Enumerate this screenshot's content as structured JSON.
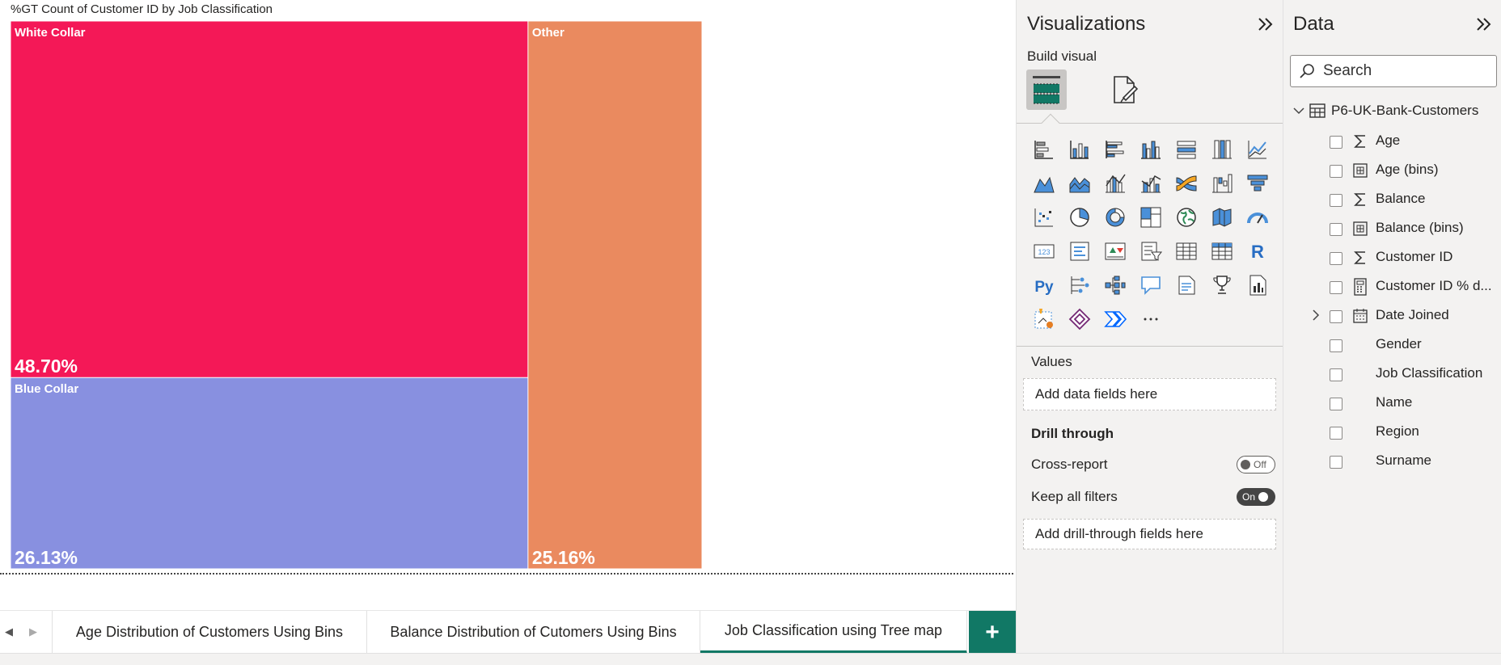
{
  "chart": {
    "title": "%GT Count of Customer ID by Job Classification"
  },
  "chart_data": {
    "type": "treemap",
    "title": "%GT Count of Customer ID by Job Classification",
    "items": [
      {
        "name": "White Collar",
        "value": 48.7,
        "label": "48.70%",
        "color": "#f41857"
      },
      {
        "name": "Blue Collar",
        "value": 26.13,
        "label": "26.13%",
        "color": "#8890e0"
      },
      {
        "name": "Other",
        "value": 25.16,
        "label": "25.16%",
        "color": "#ea8a5f"
      }
    ]
  },
  "tabs": {
    "nav_prev": "◀",
    "nav_next": "▶",
    "items": [
      {
        "label": "Age Distribution of Customers Using Bins",
        "active": false
      },
      {
        "label": "Balance Distribution of Cutomers Using Bins",
        "active": false
      },
      {
        "label": "Job Classification using Tree map",
        "active": true
      }
    ],
    "add_label": "+"
  },
  "visualizations": {
    "title": "Visualizations",
    "collapse_icon": "double-chevron-right",
    "build_visual": "Build visual",
    "values_label": "Values",
    "values_placeholder": "Add data fields here",
    "drill_through_label": "Drill through",
    "cross_report_label": "Cross-report",
    "cross_report_state": "Off",
    "keep_filters_label": "Keep all filters",
    "keep_filters_state": "On",
    "drill_placeholder": "Add drill-through fields here"
  },
  "data_pane": {
    "title": "Data",
    "search_placeholder": "Search",
    "table_name": "P6-UK-Bank-Customers",
    "fields": [
      {
        "label": "Age",
        "icon": "sum-icon"
      },
      {
        "label": "Age (bins)",
        "icon": "bins-icon"
      },
      {
        "label": "Balance",
        "icon": "sum-icon"
      },
      {
        "label": "Balance (bins)",
        "icon": "bins-icon"
      },
      {
        "label": "Customer ID",
        "icon": "sum-icon"
      },
      {
        "label": "Customer ID % d...",
        "icon": "calculator-icon"
      },
      {
        "label": "Date Joined",
        "icon": "calendar-icon"
      },
      {
        "label": "Gender",
        "icon": ""
      },
      {
        "label": "Job Classification",
        "icon": ""
      },
      {
        "label": "Name",
        "icon": ""
      },
      {
        "label": "Region",
        "icon": ""
      },
      {
        "label": "Surname",
        "icon": ""
      }
    ]
  },
  "colors": {
    "accent": "#117865"
  }
}
